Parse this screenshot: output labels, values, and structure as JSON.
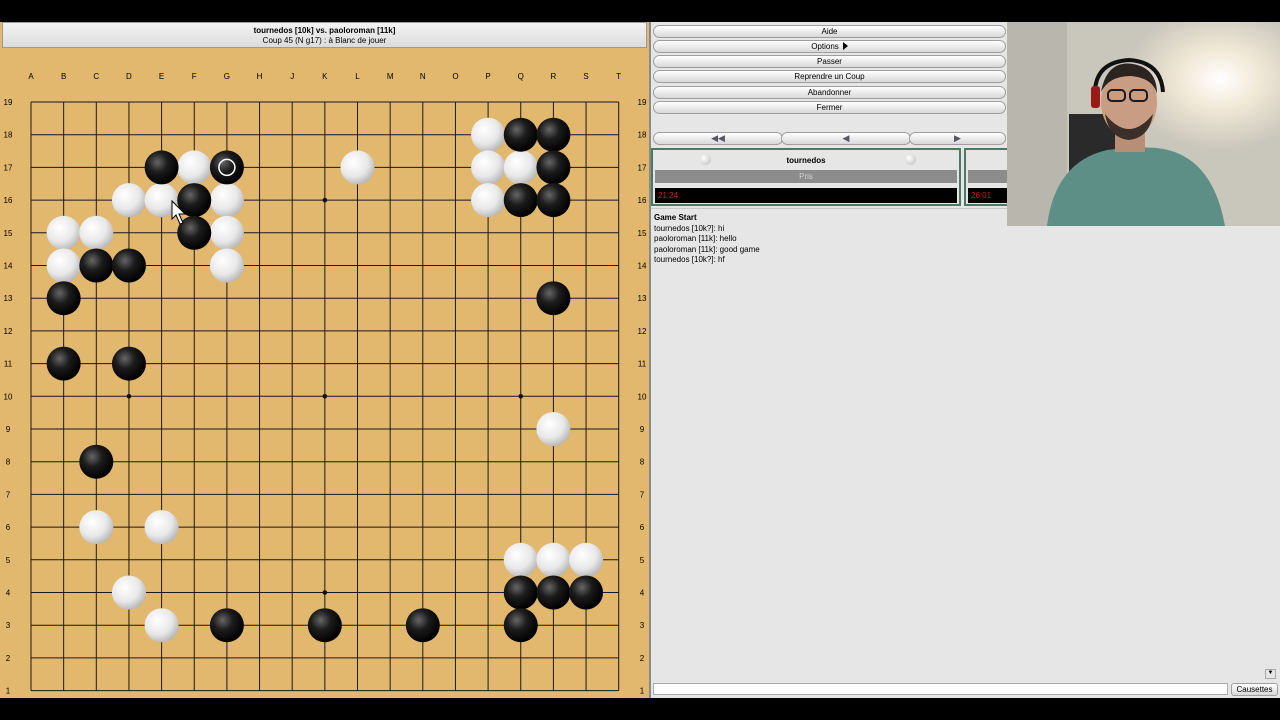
{
  "board": {
    "title": "tournedos [10k] vs. paoloroman [11k]",
    "move_info": "Coup 45 (N g17) : à Blanc de jouer",
    "columns": [
      "A",
      "B",
      "C",
      "D",
      "E",
      "F",
      "G",
      "H",
      "J",
      "K",
      "L",
      "M",
      "N",
      "O",
      "P",
      "Q",
      "R",
      "S",
      "T"
    ],
    "rows": [
      "19",
      "18",
      "17",
      "16",
      "15",
      "14",
      "13",
      "12",
      "11",
      "10",
      "9",
      "8",
      "7",
      "6",
      "5",
      "4",
      "3",
      "2",
      "1"
    ],
    "hoshi": [
      "D16",
      "K16",
      "Q16",
      "D10",
      "K10",
      "Q10",
      "D4",
      "K4",
      "Q4"
    ],
    "black_stones": [
      "E17",
      "F16",
      "F15",
      "C14",
      "D14",
      "B13",
      "B11",
      "D11",
      "C8",
      "Q18",
      "R18",
      "R17",
      "Q16",
      "R16",
      "R13",
      "Q4",
      "R4",
      "S4",
      "Q3",
      "G3",
      "K3",
      "N3"
    ],
    "white_stones": [
      "F17",
      "D16",
      "E16",
      "G16",
      "B15",
      "C15",
      "G15",
      "B14",
      "G14",
      "L17",
      "P18",
      "P17",
      "Q17",
      "P16",
      "R9",
      "C6",
      "E6",
      "Q5",
      "R5",
      "S5",
      "D4",
      "E3"
    ],
    "last_move": "G17",
    "last_move_color": "black",
    "colors": {
      "wood": "#e2b76e",
      "line": "#1a1a1a"
    }
  },
  "menu": {
    "items": [
      "Aide",
      "Options",
      "Passer",
      "Reprendre un Coup",
      "Abandonner",
      "Fermer"
    ]
  },
  "nav": {
    "back_all": "◀◀",
    "back": "◀",
    "forward": "▶"
  },
  "players": {
    "black": {
      "name": "tournedos",
      "captures_label": "Pris",
      "time": "21:24"
    },
    "white": {
      "name": "",
      "captures_label": "",
      "time": "26:01"
    }
  },
  "chat": {
    "header": "Game Start",
    "lines": [
      "tournedos [10k?]: hi",
      "paoloroman [11k]: hello",
      "paoloroman [11k]: good game",
      "tournedos [10k?]: hf"
    ],
    "input_value": "",
    "send_label": "Causettes"
  }
}
